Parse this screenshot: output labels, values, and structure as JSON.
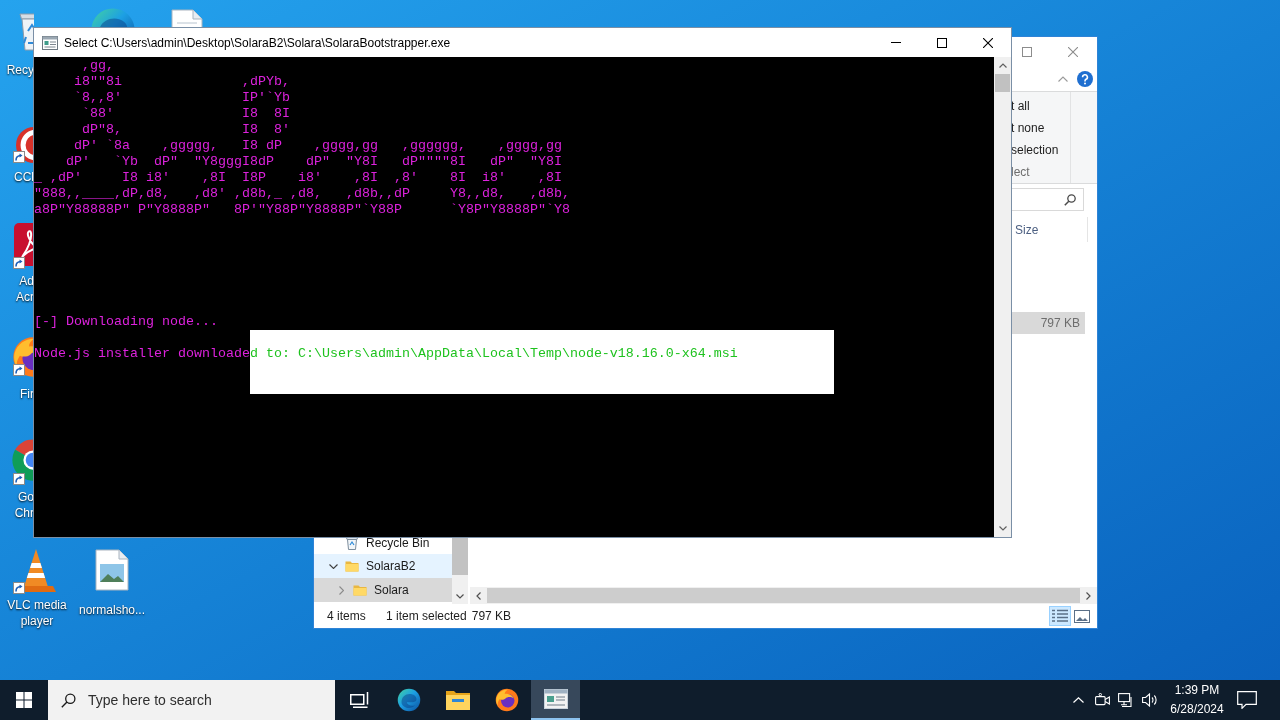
{
  "desktop_icons": [
    {
      "kind": "recycle-bin",
      "label_lines": [
        "Recy"
      ],
      "shortcut": false
    },
    {
      "kind": "edge"
    },
    {
      "kind": "document"
    },
    {
      "kind": "ccleaner",
      "label_lines": [
        "CCl"
      ],
      "shortcut": true
    },
    {
      "kind": "acrobat",
      "label_lines": [
        "Ad",
        "Acr"
      ],
      "shortcut": true
    },
    {
      "kind": "firefox",
      "label_lines": [
        "Fir"
      ],
      "shortcut": true
    },
    {
      "kind": "chrome",
      "label_lines": [
        "Go",
        "Chr"
      ],
      "shortcut": true
    },
    {
      "kind": "vlc",
      "label_lines": [
        "VLC media",
        "player"
      ],
      "shortcut": true
    },
    {
      "kind": "image-file",
      "label_lines": [
        "normalsho..."
      ],
      "shortcut": false
    }
  ],
  "console_window": {
    "title": "Select C:\\Users\\admin\\Desktop\\SolaraB2\\Solara\\SolaraBootstrapper.exe",
    "banner": [
      "      ,gg,",
      "     i8\"\"8i               ,dPYb,",
      "     `8,,8'               IP'`Yb",
      "      `88'                I8  8I",
      "      dP\"8,               I8  8'",
      "     dP' `8a    ,ggggg,   I8 dP    ,gggg,gg   ,gggggg,    ,gggg,gg",
      "    dP'   `Yb  dP\"  \"Y8gggI8dP    dP\"  \"Y8I   dP\"\"\"\"8I   dP\"  \"Y8I",
      "_ ,dP'     I8 i8'    ,8I  I8P    i8'    ,8I  ,8'    8I  i8'    ,8I",
      "\"888,,____,dP,d8,   ,d8' ,d8b,_ ,d8,   ,d8b,,dP     Y8,,d8,   ,d8b,",
      "a8P\"Y88888P\" P\"Y8888P\"   8P'\"Y88P\"Y8888P\"`Y88P      `Y8P\"Y8888P\"`Y8"
    ],
    "output": [
      {
        "segments": [
          {
            "text": "[-] Downloading node...",
            "selected": false
          }
        ]
      },
      {
        "segments": [
          {
            "text": "Node.js installer downloade",
            "selected": false
          },
          {
            "text": "d to: C:\\Users\\admin\\AppData\\Local\\Temp\\node-v18.16.0-x64.msi",
            "selected": true
          }
        ]
      }
    ]
  },
  "explorer_window": {
    "ribbon": {
      "commands": [
        "t all",
        "t none",
        "selection"
      ],
      "group_label": "lect"
    },
    "file_list": {
      "columns": [
        "Size"
      ],
      "rows": [
        {
          "selected": true,
          "size": "797 KB"
        }
      ]
    },
    "navigation": [
      {
        "kind": "recycle-bin",
        "label": "Recycle Bin",
        "selected": false,
        "hovered": false
      },
      {
        "kind": "folder",
        "label": "SolaraB2",
        "expanded": true,
        "selected": false,
        "hovered": true,
        "children": [
          {
            "kind": "folder",
            "label": "Solara",
            "expanded": false,
            "selected": true,
            "hovered": false
          }
        ]
      }
    ],
    "status_bar": {
      "item_count": "4 items",
      "selection": "1 item selected",
      "size": "797 KB"
    },
    "view_buttons": [
      {
        "kind": "details",
        "selected": true
      },
      {
        "kind": "large-icons",
        "selected": false
      }
    ]
  },
  "taskbar": {
    "search": {
      "placeholder": "Type here to search"
    },
    "apps": [
      {
        "kind": "task-view",
        "selected": false
      },
      {
        "kind": "edge",
        "selected": false
      },
      {
        "kind": "file-explorer",
        "selected": false
      },
      {
        "kind": "firefox",
        "selected": false
      },
      {
        "kind": "console",
        "selected": true
      }
    ],
    "clock": {
      "time": "1:39 PM",
      "date": "6/28/2024"
    }
  }
}
